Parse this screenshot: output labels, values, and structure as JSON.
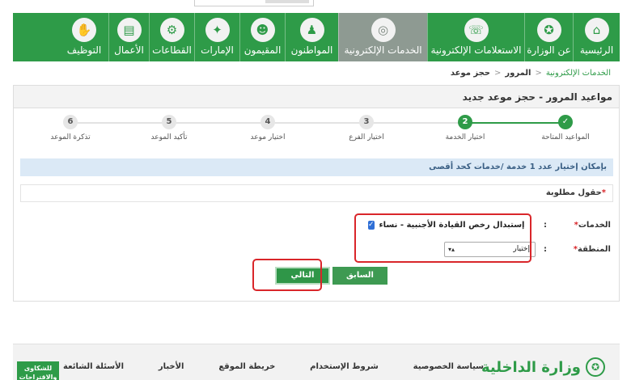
{
  "nav": {
    "items": [
      {
        "label": "الرئيسية",
        "icon": "⌂"
      },
      {
        "label": "عن الوزارة",
        "icon": "✪"
      },
      {
        "label": "الاستعلامات الإلكترونية",
        "icon": "☏"
      },
      {
        "label": "الخدمات الإلكترونية",
        "icon": "◎"
      },
      {
        "label": "المواطنون",
        "icon": "♟"
      },
      {
        "label": "المقيمون",
        "icon": "☻"
      },
      {
        "label": "الإمارات",
        "icon": "✦"
      },
      {
        "label": "القطاعات",
        "icon": "⚙"
      },
      {
        "label": "الأعمال",
        "icon": "▤"
      },
      {
        "label": "التوظيف",
        "icon": "✋"
      }
    ]
  },
  "breadcrumb": {
    "link": "الخدمات الإلكترونية",
    "mid": "المرور",
    "current": "حجز موعد",
    "sep": ">"
  },
  "panel": {
    "title": "مواعيد المرور - حجز موعد جديد"
  },
  "steps": [
    {
      "num": "✓",
      "label": "المواعيد المتاحة",
      "state": "done"
    },
    {
      "num": "2",
      "label": "اختيار الخدمة",
      "state": "current"
    },
    {
      "num": "3",
      "label": "اختيار الفرع",
      "state": "pending"
    },
    {
      "num": "4",
      "label": "اختيار موعد",
      "state": "pending"
    },
    {
      "num": "5",
      "label": "تأكيد الموعد",
      "state": "pending"
    },
    {
      "num": "6",
      "label": "تذكرة الموعد",
      "state": "pending"
    }
  ],
  "info": {
    "text": "بإمكان إختيار عدد 1 خدمة /خدمات كحد أقصى"
  },
  "required": {
    "star": "*",
    "text": "حقول مطلوبة"
  },
  "form": {
    "services_label": "الخدمات",
    "region_label": "المنطقة",
    "star": "*",
    "colon": ":",
    "service_option": "إستبدال رخص القيادة الأجنبية - نساء",
    "checkbox_mark": "✓",
    "region_value": "إختيار",
    "select_arrows": "▴▾"
  },
  "buttons": {
    "prev": "السابق",
    "next": "التالي"
  },
  "footer": {
    "logo_text": "وزارة الداخلية",
    "logo_icon": "✪",
    "links": [
      "سياسة الخصوصية",
      "شروط الإستخدام",
      "خريطة الموقع",
      "الأخبار",
      "الأسئلة الشائعة"
    ],
    "complaints_line1": "للشكاوى",
    "complaints_line2": "والاقتراحات"
  }
}
